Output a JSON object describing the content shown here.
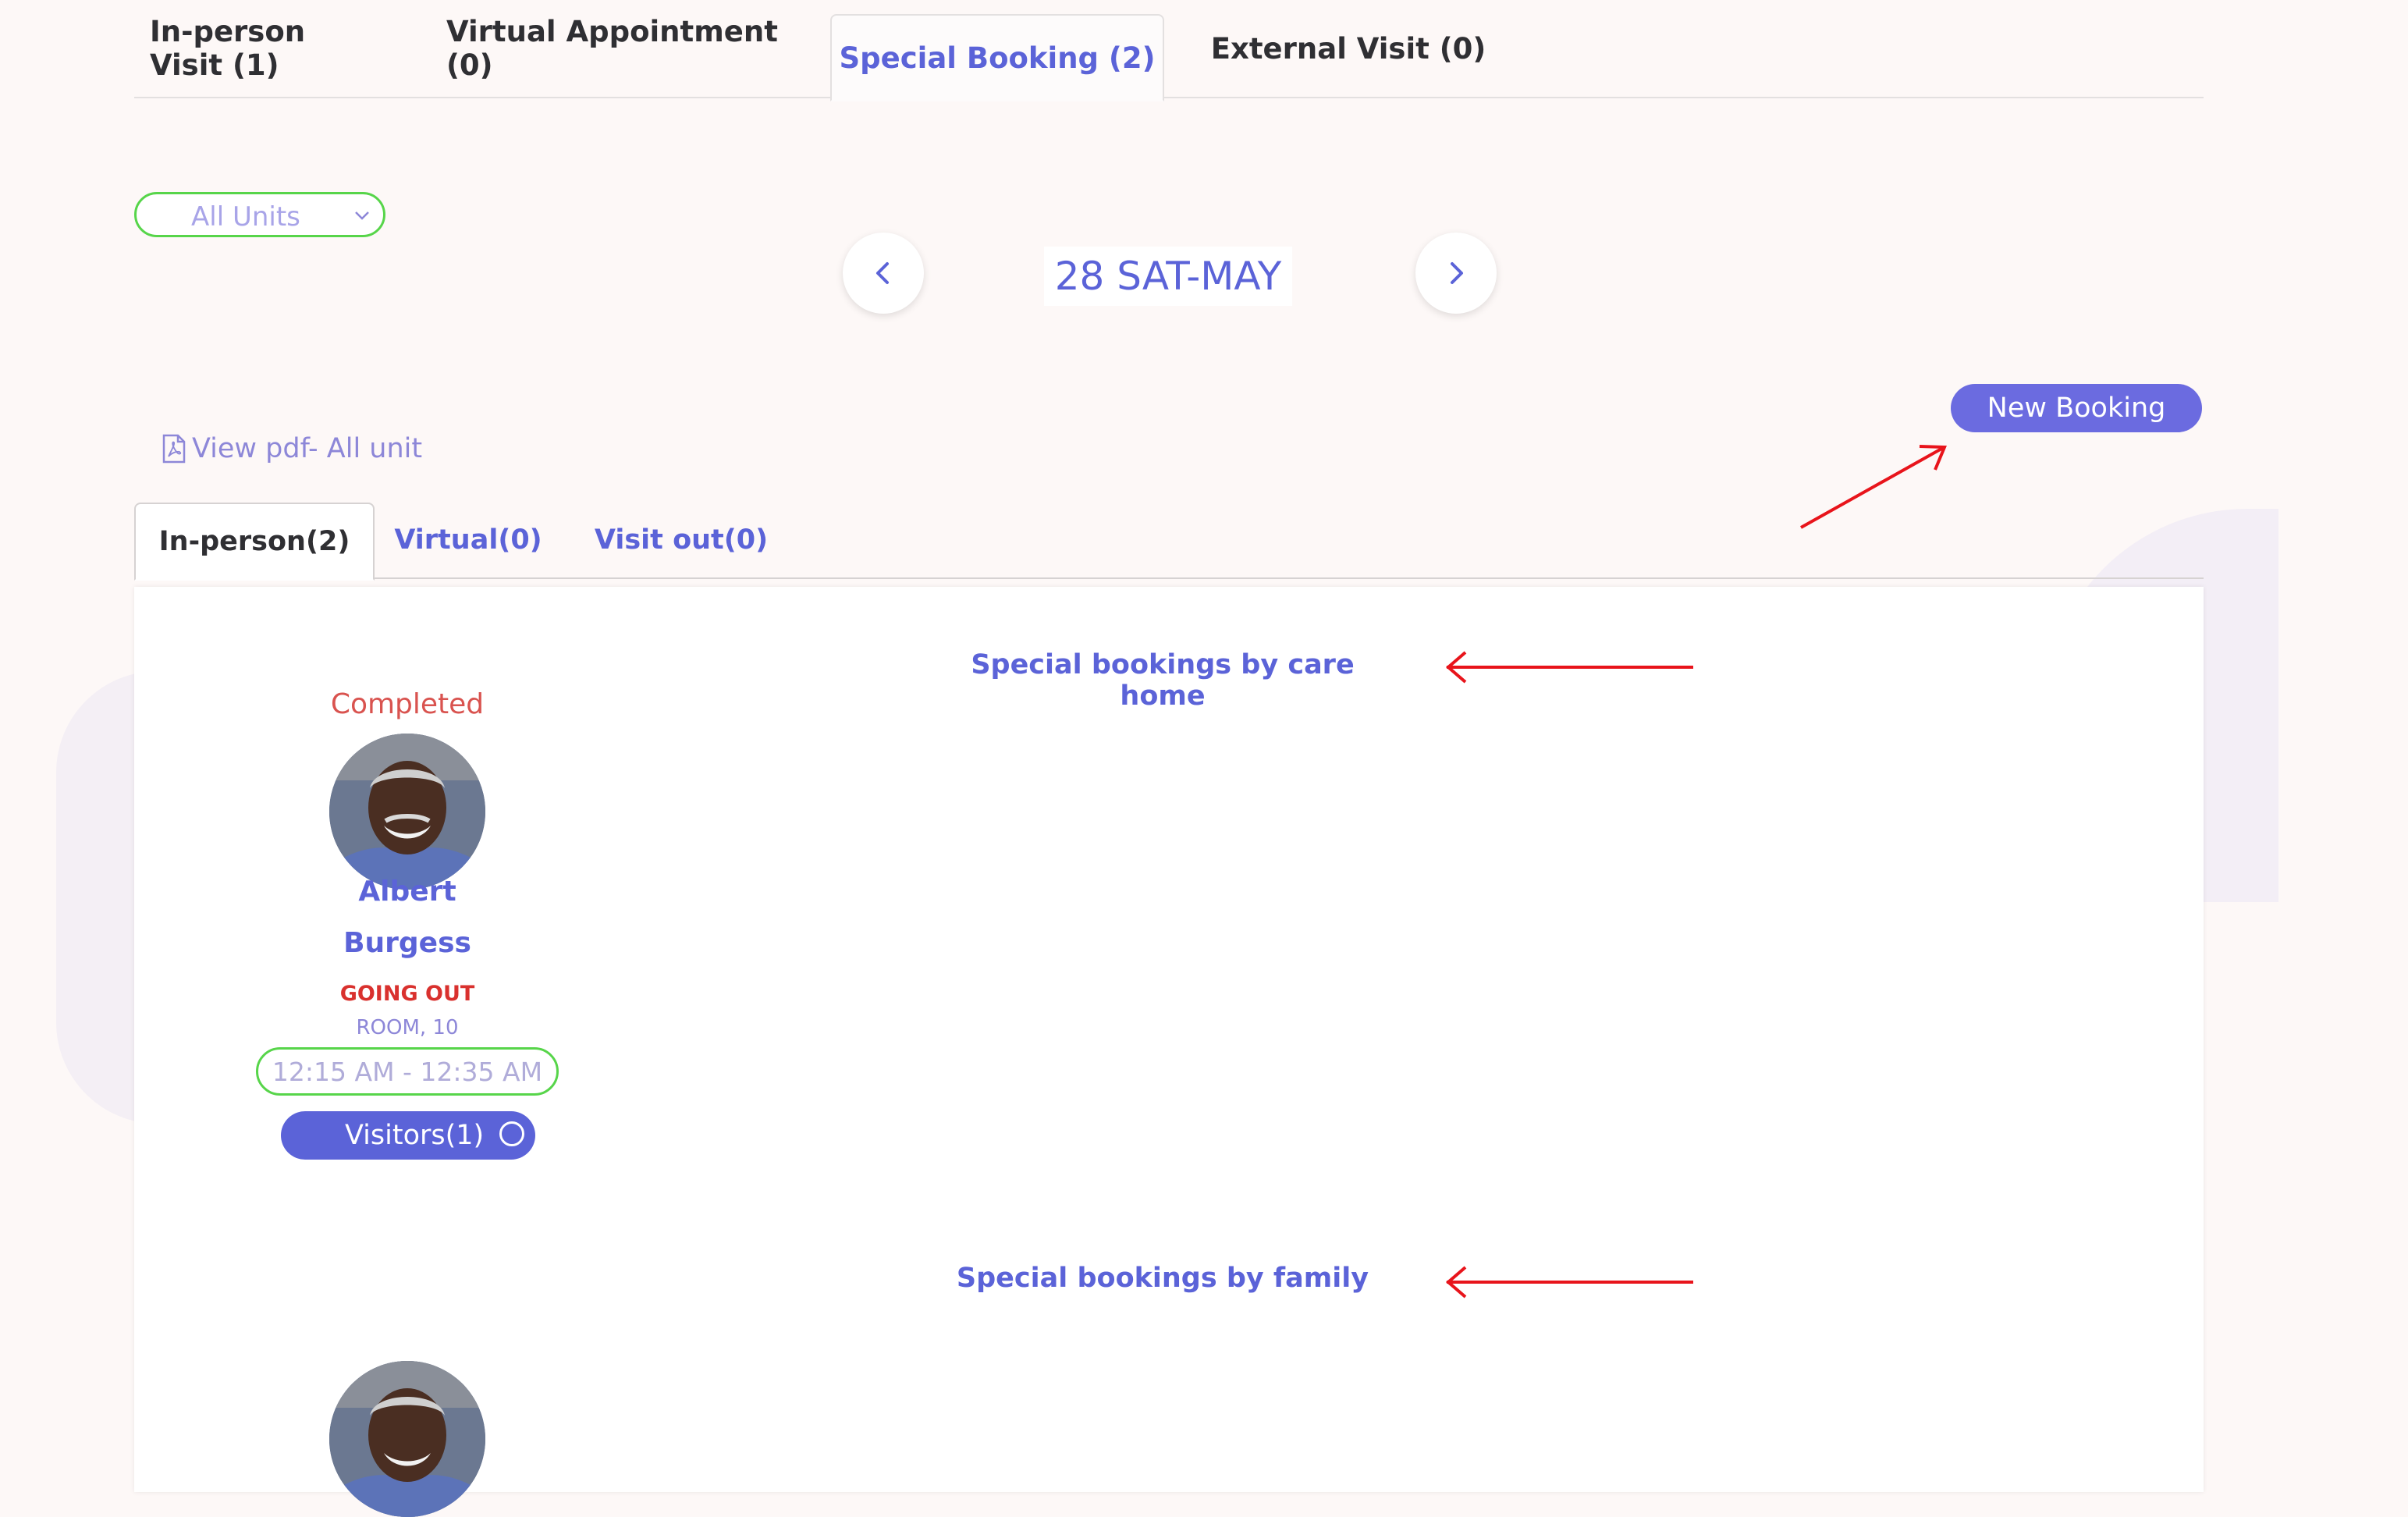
{
  "top_tabs": [
    {
      "label": "In-person Visit (1)"
    },
    {
      "label": "Virtual Appointment (0)"
    },
    {
      "label": "Special Booking (2)"
    },
    {
      "label": "External Visit (0)"
    }
  ],
  "unit_filter": {
    "selected": "All Units"
  },
  "date_nav": {
    "current": "28 SAT-MAY"
  },
  "actions": {
    "new_booking": "New Booking",
    "view_pdf": "View pdf- All unit"
  },
  "sub_tabs": [
    {
      "label": "In-person(2)"
    },
    {
      "label": "Virtual(0)"
    },
    {
      "label": "Visit out(0)"
    }
  ],
  "sections": {
    "care_home": {
      "title": "Special bookings by care home",
      "booking": {
        "status": "Completed",
        "first_name": "Albert",
        "last_name": "Burgess",
        "activity": "GOING OUT",
        "room": "ROOM, 10",
        "time": "12:15 AM - 12:35 AM",
        "visitors": "Visitors(1)"
      }
    },
    "family": {
      "title": "Special bookings by family"
    }
  },
  "colors": {
    "accent": "#5b63d8",
    "success_outline": "#57d54a",
    "alert": "#d9312e",
    "annotation": "#e8141b"
  }
}
